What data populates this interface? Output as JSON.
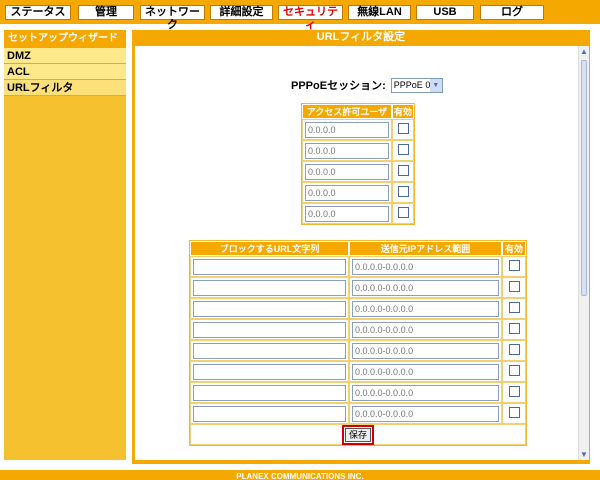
{
  "nav": {
    "tabs": [
      {
        "label": "ステータス"
      },
      {
        "label": "管理"
      },
      {
        "label": "ネットワーク"
      },
      {
        "label": "詳細設定"
      },
      {
        "label": "セキュリティ"
      },
      {
        "label": "無線LAN"
      },
      {
        "label": "USB"
      },
      {
        "label": "ログ"
      }
    ],
    "active_color": "#e00000"
  },
  "sidebar": {
    "header": "セットアップウィザード",
    "items": [
      {
        "label": "DMZ"
      },
      {
        "label": "ACL"
      },
      {
        "label": "URLフィルタ"
      }
    ]
  },
  "panel": {
    "title": "URLフィルタ設定",
    "session_label": "PPPoEセッション:",
    "session_value": "PPPoE 0"
  },
  "users_table": {
    "headers": [
      "アクセス許可ユーザ",
      "有効"
    ],
    "rows": [
      {
        "placeholder": "0.0.0.0"
      },
      {
        "placeholder": "0.0.0.0"
      },
      {
        "placeholder": "0.0.0.0"
      },
      {
        "placeholder": "0.0.0.0"
      },
      {
        "placeholder": "0.0.0.0"
      }
    ]
  },
  "url_table": {
    "headers": [
      "ブロックするURL文字列",
      "送信元IPアドレス範囲",
      "有効"
    ],
    "rows": [
      {
        "range_placeholder": "0.0.0.0-0.0.0.0"
      },
      {
        "range_placeholder": "0.0.0.0-0.0.0.0"
      },
      {
        "range_placeholder": "0.0.0.0-0.0.0.0"
      },
      {
        "range_placeholder": "0.0.0.0-0.0.0.0"
      },
      {
        "range_placeholder": "0.0.0.0-0.0.0.0"
      },
      {
        "range_placeholder": "0.0.0.0-0.0.0.0"
      },
      {
        "range_placeholder": "0.0.0.0-0.0.0.0"
      },
      {
        "range_placeholder": "0.0.0.0-0.0.0.0"
      }
    ],
    "save_label": "保存"
  },
  "footer": {
    "text": "PLANEX COMMUNICATIONS INC."
  },
  "colors": {
    "accent": "#f5a800",
    "sidebar": "#f6c12f",
    "highlight": "#d00000"
  },
  "icons": {
    "scroll_up": "triangle-up-icon",
    "scroll_down": "triangle-down-icon",
    "dropdown": "chevron-down-icon"
  }
}
